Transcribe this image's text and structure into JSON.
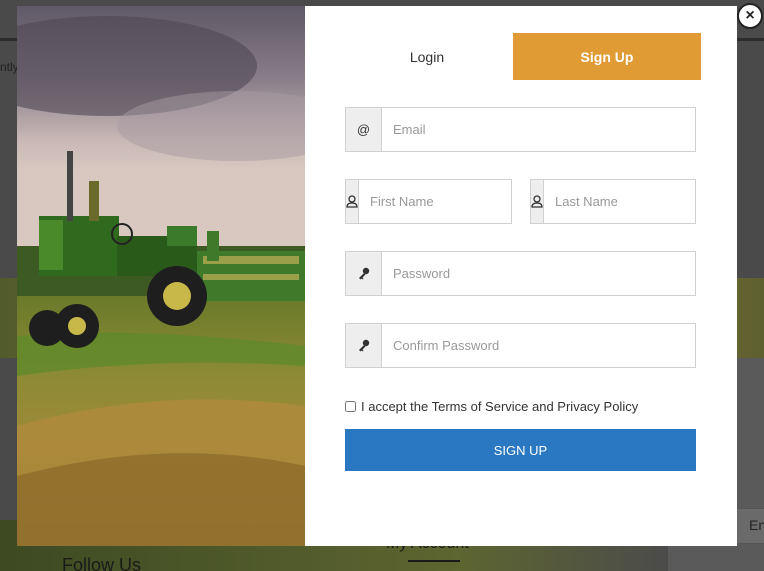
{
  "background": {
    "left_fragment": "ntly",
    "follow_heading": "Follow Us",
    "account_heading": "My Account",
    "right_box_text": "En"
  },
  "modal": {
    "tabs": [
      {
        "label": "Login",
        "active": false
      },
      {
        "label": "Sign Up",
        "active": true
      }
    ],
    "fields": {
      "email": {
        "placeholder": "Email",
        "icon": "at-icon",
        "value": ""
      },
      "first_name": {
        "placeholder": "First Name",
        "icon": "user-icon",
        "value": ""
      },
      "last_name": {
        "placeholder": "Last Name",
        "icon": "user-icon",
        "value": ""
      },
      "password": {
        "placeholder": "Password",
        "icon": "key-icon",
        "value": ""
      },
      "confirm_password": {
        "placeholder": "Confirm Password",
        "icon": "key-icon",
        "value": ""
      }
    },
    "at_symbol": "@",
    "terms_label": "I accept the Terms of Service and Privacy Policy",
    "terms_checked": false,
    "submit_label": "SIGN UP",
    "close_symbol": "×"
  },
  "colors": {
    "accent_orange": "#e09b34",
    "button_blue": "#2a78c2"
  }
}
